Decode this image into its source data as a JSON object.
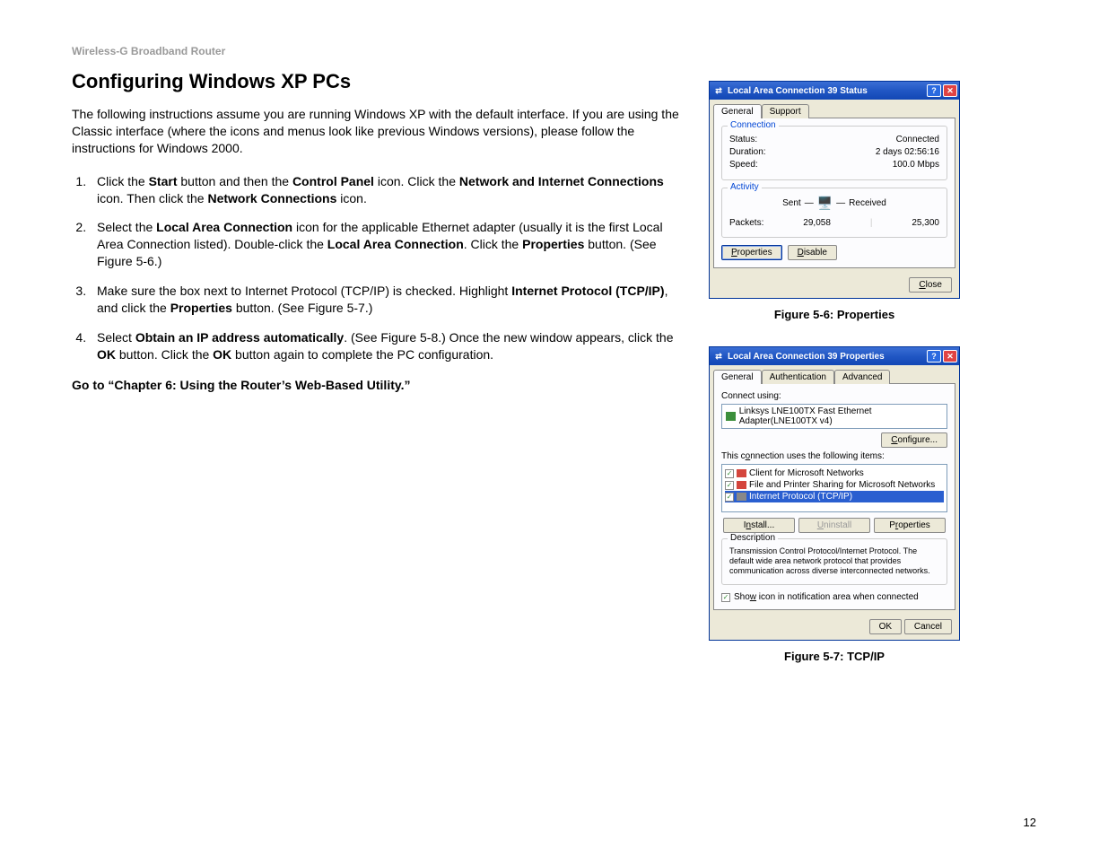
{
  "header": "Wireless-G Broadband Router",
  "title": "Configuring Windows XP PCs",
  "intro": "The following instructions assume you are running Windows XP with the default interface. If you are using the Classic interface (where the icons and menus look like previous Windows versions), please follow the instructions for Windows 2000.",
  "steps": {
    "s1a": "Click the ",
    "s1b": "Start",
    "s1c": " button and then the ",
    "s1d": "Control Panel",
    "s1e": " icon. Click the ",
    "s1f": "Network and Internet Connections",
    "s1g": " icon. Then click the ",
    "s1h": "Network Connections",
    "s1i": " icon.",
    "s2a": "Select the ",
    "s2b": "Local Area Connection",
    "s2c": " icon for the applicable Ethernet adapter (usually it is the first Local Area Connection listed). Double-click the ",
    "s2d": "Local Area Connection",
    "s2e": ". Click the ",
    "s2f": "Properties",
    "s2g": " button. (See Figure 5-6.)",
    "s3a": "Make sure the box next to Internet Protocol (TCP/IP) is checked. Highlight ",
    "s3b": "Internet Protocol (TCP/IP)",
    "s3c": ", and click the ",
    "s3d": "Properties",
    "s3e": " button. (See Figure 5-7.)",
    "s4a": "Select ",
    "s4b": "Obtain an IP address automatically",
    "s4c": ". (See Figure 5-8.) Once the new window appears, click the ",
    "s4d": "OK",
    "s4e": " button. Click the ",
    "s4f": "OK",
    "s4g": " button again to complete the PC configuration."
  },
  "goto": "Go to “Chapter 6: Using the Router’s Web-Based Utility.”",
  "pagenum": "12",
  "fig1": {
    "caption": "Figure 5-6: Properties",
    "title": "Local Area Connection 39 Status",
    "tab_general": "General",
    "tab_support": "Support",
    "grp_conn": "Connection",
    "status_l": "Status:",
    "status_v": "Connected",
    "duration_l": "Duration:",
    "duration_v": "2 days 02:56:16",
    "speed_l": "Speed:",
    "speed_v": "100.0 Mbps",
    "grp_act": "Activity",
    "sent": "Sent",
    "received": "Received",
    "packets_l": "Packets:",
    "packets_sent": "29,058",
    "packets_recv": "25,300",
    "btn_properties": "Properties",
    "btn_disable": "Disable",
    "btn_close": "Close"
  },
  "fig2": {
    "caption": "Figure 5-7: TCP/IP",
    "title": "Local Area Connection 39 Properties",
    "tab_general": "General",
    "tab_auth": "Authentication",
    "tab_adv": "Advanced",
    "connect_using": "Connect using:",
    "adapter": "Linksys LNE100TX Fast Ethernet Adapter(LNE100TX v4)",
    "btn_configure": "Configure...",
    "items_label": "This connection uses the following items:",
    "item1": "Client for Microsoft Networks",
    "item2": "File and Printer Sharing for Microsoft Networks",
    "item3": "Internet Protocol (TCP/IP)",
    "btn_install": "Install...",
    "btn_uninstall": "Uninstall",
    "btn_properties": "Properties",
    "grp_desc": "Description",
    "desc": "Transmission Control Protocol/Internet Protocol. The default wide area network protocol that provides communication across diverse interconnected networks.",
    "show_icon": "Show icon in notification area when connected",
    "btn_ok": "OK",
    "btn_cancel": "Cancel"
  }
}
